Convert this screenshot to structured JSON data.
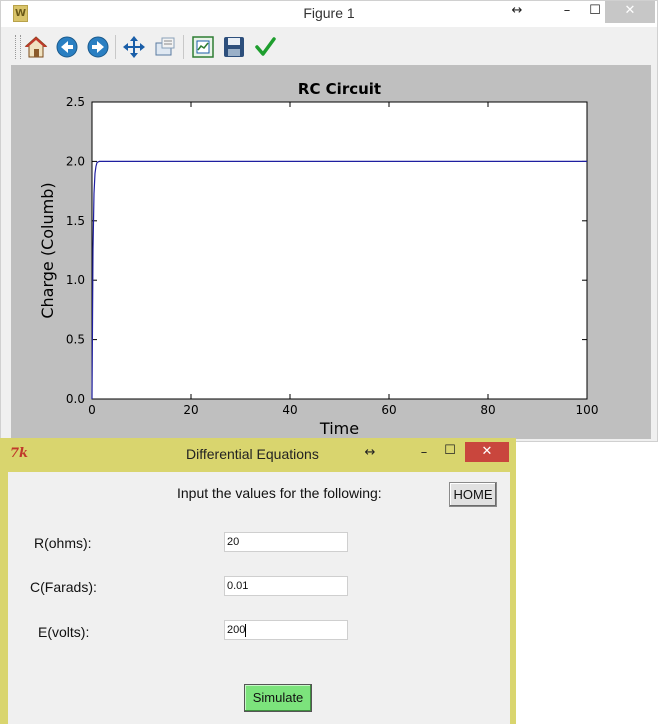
{
  "figure_window": {
    "title": "Figure 1",
    "buttons": {
      "resize": "↔",
      "minimize": "–",
      "maximize": "☐",
      "close": "✕"
    },
    "toolbar": {
      "items": [
        "home-icon",
        "back-icon",
        "forward-icon",
        "pan-icon",
        "zoom-icon",
        "subplots-icon",
        "save-icon",
        "check-icon"
      ]
    }
  },
  "chart_data": {
    "type": "line",
    "title": "RC Circuit",
    "xlabel": "Time",
    "ylabel": "Charge (Columb)",
    "xlim": [
      0,
      100
    ],
    "ylim": [
      0.0,
      2.5
    ],
    "xticks": [
      "0",
      "20",
      "40",
      "60",
      "80",
      "100"
    ],
    "yticks": [
      "0.0",
      "0.5",
      "1.0",
      "1.5",
      "2.0",
      "2.5"
    ],
    "grid": false,
    "series": [
      {
        "color": "#1f1fa0",
        "x": [
          0,
          0.2,
          0.4,
          0.6,
          0.8,
          1.0,
          1.2,
          1.5,
          2.0,
          3.0,
          5.0,
          100
        ],
        "y": [
          0.0,
          1.26,
          1.73,
          1.9,
          1.96,
          1.99,
          1.995,
          2.0,
          2.0,
          2.0,
          2.0,
          2.0
        ]
      }
    ]
  },
  "dialog": {
    "title": "Differential Equations",
    "buttons": {
      "resize": "↔",
      "minimize": "–",
      "maximize": "☐",
      "close": "✕"
    },
    "heading": "Input the values for the following:",
    "home_label": "HOME",
    "fields": [
      {
        "label": "R(ohms):",
        "value": "20"
      },
      {
        "label": "C(Farads):",
        "value": "0.01"
      },
      {
        "label": "E(volts):",
        "value": "200"
      }
    ],
    "simulate_label": "Simulate"
  }
}
